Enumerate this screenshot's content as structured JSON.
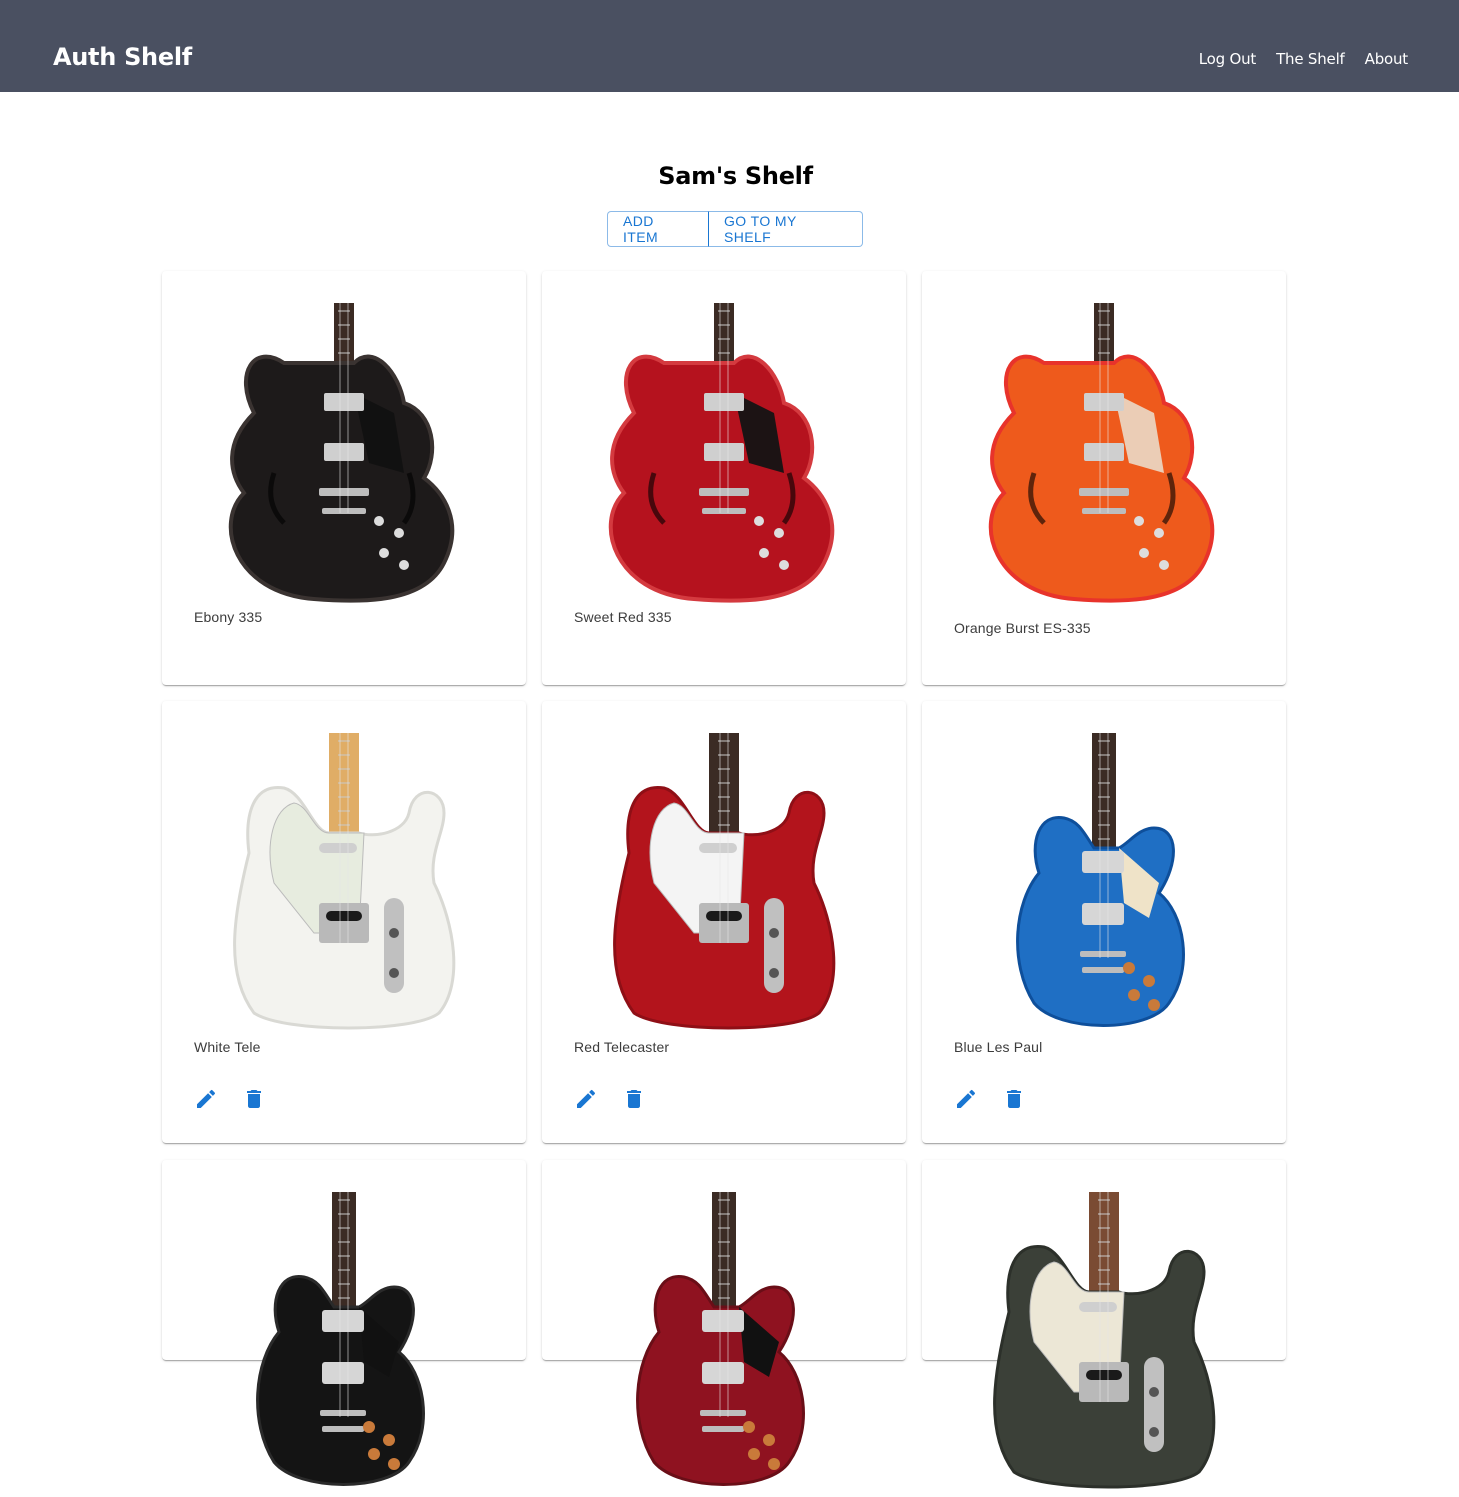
{
  "nav": {
    "title": "Auth Shelf",
    "links": [
      "Log Out",
      "The Shelf",
      "About"
    ]
  },
  "page": {
    "title": "Sam's Shelf",
    "add_button": "ADD ITEM",
    "my_shelf_button": "GO TO MY SHELF"
  },
  "items": [
    {
      "label": "Ebony 335",
      "style": "semi-hollow",
      "body_color": "#1d1a1a",
      "body_edge": "#3a3331",
      "pickguard": "#111111",
      "neck": "#3b2b24",
      "editable": false
    },
    {
      "label": "Sweet Red 335",
      "style": "semi-hollow",
      "body_color": "#b5121e",
      "body_edge": "#d43a3f",
      "pickguard": "#141414",
      "neck": "#3b2b24",
      "editable": false
    },
    {
      "label": "Orange Burst ES-335",
      "style": "semi-hollow",
      "body_color": "#ee5a1c",
      "body_edge": "#e8332b",
      "pickguard": "#ead4bf",
      "neck": "#3b2b24",
      "editable": false
    },
    {
      "label": "White Tele",
      "style": "tele",
      "body_color": "#f3f3ef",
      "body_edge": "#d9d9d4",
      "pickguard": "#e7ecdf",
      "neck": "#e0ad66",
      "editable": true
    },
    {
      "label": "Red Telecaster",
      "style": "tele",
      "body_color": "#b3141c",
      "body_edge": "#8f0f16",
      "pickguard": "#f4f4f4",
      "neck": "#3b2b24",
      "editable": true
    },
    {
      "label": "Blue Les Paul",
      "style": "lespaul",
      "body_color": "#1f6fc4",
      "body_edge": "#0e4f9b",
      "pickguard": "#efe3c8",
      "neck": "#3b2b24",
      "editable": true
    },
    {
      "label": "",
      "style": "lespaul",
      "body_color": "#141414",
      "body_edge": "#2a2a2a",
      "pickguard": "#111111",
      "neck": "#3b2b24",
      "editable": false
    },
    {
      "label": "",
      "style": "lespaul",
      "body_color": "#8f1220",
      "body_edge": "#6a0e17",
      "pickguard": "#111111",
      "neck": "#3b2b24",
      "editable": false
    },
    {
      "label": "",
      "style": "tele",
      "body_color": "#3b4038",
      "body_edge": "#2c302a",
      "pickguard": "#ece7d6",
      "neck": "#7a4b33",
      "editable": false
    }
  ],
  "icons": {
    "edit": "pencil-icon",
    "delete": "trash-icon"
  },
  "colors": {
    "nav_bg": "#4a5061",
    "accent": "#1976d2"
  }
}
